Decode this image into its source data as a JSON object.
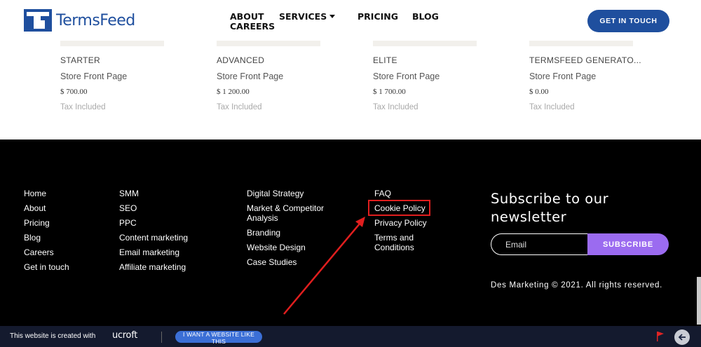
{
  "header": {
    "logo_text": "TermsFeed",
    "nav": {
      "about": "ABOUT",
      "careers": "CAREERS",
      "services": "SERVICES",
      "pricing": "PRICING",
      "blog": "BLOG"
    },
    "cta_label": "GET IN TOUCH"
  },
  "products": [
    {
      "name": "STARTER",
      "desc": "Store Front Page",
      "price": "$ 700.00",
      "tax": "Tax Included"
    },
    {
      "name": "ADVANCED",
      "desc": "Store Front Page",
      "price": "$ 1 200.00",
      "tax": "Tax Included"
    },
    {
      "name": "ELITE",
      "desc": "Store Front Page",
      "price": "$ 1 700.00",
      "tax": "Tax Included"
    },
    {
      "name": "TERMSFEED GENERATO...",
      "desc": "Store Front Page",
      "price": "$ 0.00",
      "tax": "Tax Included"
    }
  ],
  "footer": {
    "col1": [
      "Home",
      "About",
      "Pricing",
      "Blog",
      "Careers",
      "Get in touch"
    ],
    "col2": [
      "SMM",
      "SEO",
      "PPC",
      "Content marketing",
      "Email marketing",
      "Affiliate marketing"
    ],
    "col3": [
      "Digital Strategy",
      "Market & Competitor Analysis",
      "Branding",
      "Website Design",
      "Case Studies"
    ],
    "col4": [
      "FAQ",
      "Cookie Policy",
      "Privacy Policy",
      "Terms and Conditions"
    ],
    "subscribe_title": "Subscribe to our newsletter",
    "email_placeholder": "Email",
    "subscribe_label": "SUBSCRIBE",
    "copyright": "Des Marketing © 2021. All rights reserved."
  },
  "bottom_bar": {
    "made_with": "This website is created with",
    "brand": "ucroft",
    "want_label": "I WANT A WEBSITE LIKE THIS"
  },
  "colors": {
    "brand_blue": "#1f4f9e",
    "subscribe_purple": "#9b6bf0",
    "highlight_red": "#e01e1e",
    "bottom_bar": "#141a2e"
  },
  "icons": [
    "termsfeed-logo-icon",
    "chevron-down-icon",
    "flag-icon",
    "arrow-left-icon"
  ]
}
